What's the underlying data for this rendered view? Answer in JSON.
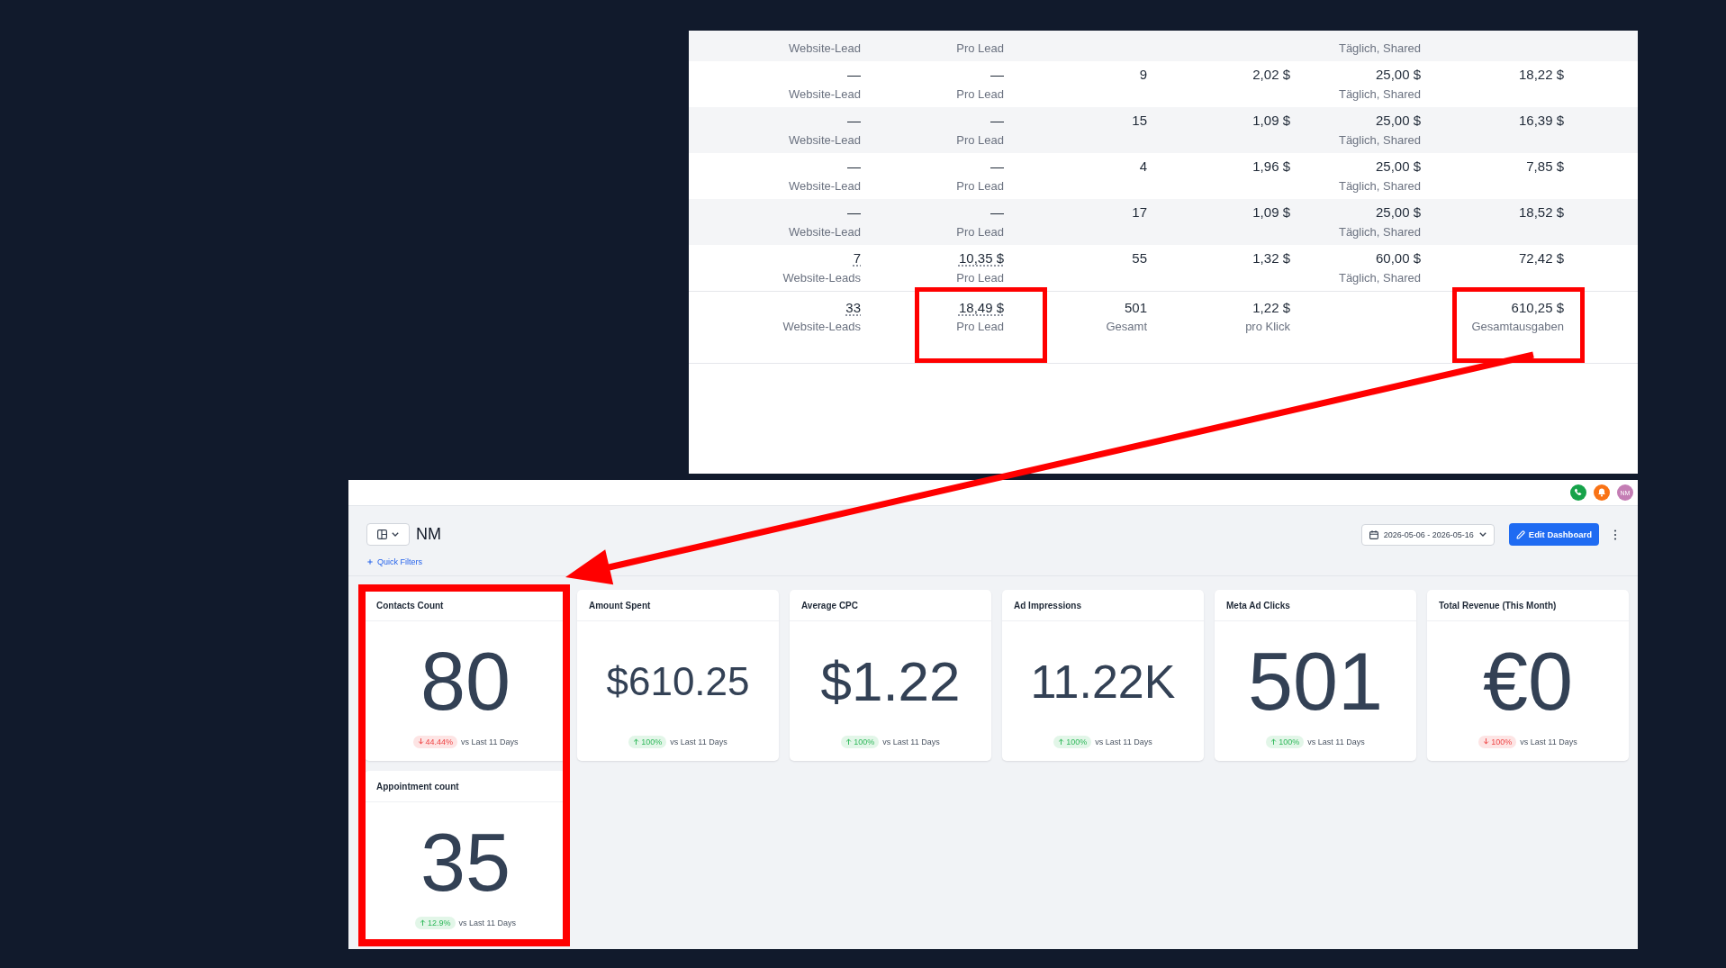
{
  "table_panel": {
    "rows": [
      {
        "column_1": {
          "sub": "Website-Lead"
        },
        "column_2": {
          "sub": "Pro Lead"
        },
        "column_5": {
          "sub": "Täglich, Shared"
        }
      },
      {
        "column_1": {
          "value": "—",
          "sub": "Website-Lead",
          "dotted": false
        },
        "column_2": {
          "value": "—",
          "sub": "Pro Lead",
          "dotted": false
        },
        "column_3": {
          "value": "9",
          "dotted": false
        },
        "column_4": {
          "value": "2,02 $",
          "dotted": false
        },
        "column_5": {
          "value": "25,00 $",
          "sub": "Täglich, Shared",
          "dotted": false
        },
        "column_6": {
          "value": "18,22 $",
          "dotted": false
        }
      },
      {
        "column_1": {
          "value": "—",
          "sub": "Website-Lead",
          "dotted": false
        },
        "column_2": {
          "value": "—",
          "sub": "Pro Lead",
          "dotted": false
        },
        "column_3": {
          "value": "15",
          "dotted": false
        },
        "column_4": {
          "value": "1,09 $",
          "dotted": false
        },
        "column_5": {
          "value": "25,00 $",
          "sub": "Täglich, Shared",
          "dotted": false
        },
        "column_6": {
          "value": "16,39 $",
          "dotted": false
        }
      },
      {
        "column_1": {
          "value": "—",
          "sub": "Website-Lead",
          "dotted": false
        },
        "column_2": {
          "value": "—",
          "sub": "Pro Lead",
          "dotted": false
        },
        "column_3": {
          "value": "4",
          "dotted": false
        },
        "column_4": {
          "value": "1,96 $",
          "dotted": false
        },
        "column_5": {
          "value": "25,00 $",
          "sub": "Täglich, Shared",
          "dotted": false
        },
        "column_6": {
          "value": "7,85 $",
          "dotted": false
        }
      },
      {
        "column_1": {
          "value": "—",
          "sub": "Website-Lead",
          "dotted": false
        },
        "column_2": {
          "value": "—",
          "sub": "Pro Lead",
          "dotted": false
        },
        "column_3": {
          "value": "17",
          "dotted": false
        },
        "column_4": {
          "value": "1,09 $",
          "dotted": false
        },
        "column_5": {
          "value": "25,00 $",
          "sub": "Täglich, Shared",
          "dotted": false
        },
        "column_6": {
          "value": "18,52 $",
          "dotted": false
        }
      },
      {
        "column_1": {
          "value": "7",
          "sub": "Website-Leads",
          "dotted": true
        },
        "column_2": {
          "value": "10,35 $",
          "sub": "Pro Lead",
          "dotted": true
        },
        "column_3": {
          "value": "55",
          "dotted": false
        },
        "column_4": {
          "value": "1,32 $",
          "dotted": false
        },
        "column_5": {
          "value": "60,00 $",
          "sub": "Täglich, Shared",
          "dotted": false
        },
        "column_6": {
          "value": "72,42 $",
          "dotted": false
        }
      }
    ],
    "totals": {
      "column_1": {
        "value": "33",
        "sub": "Website-Leads",
        "dotted": true,
        "highlighted": false
      },
      "column_2": {
        "value": "18,49 $",
        "sub": "Pro Lead",
        "dotted": true,
        "highlighted": true
      },
      "column_3": {
        "value": "501",
        "sub": "Gesamt",
        "dotted": false,
        "highlighted": false
      },
      "column_4": {
        "value": "1,22 $",
        "sub": "pro Klick",
        "dotted": false,
        "highlighted": false
      },
      "column_6": {
        "value": "610,25 $",
        "sub": "Gesamtausgaben",
        "dotted": false,
        "highlighted": true
      }
    }
  },
  "arrow_shown": true,
  "dashboard": {
    "top_bar": {
      "avatar_initials": "NM"
    },
    "title": "NM",
    "quick_filters": "Quick Filters",
    "date_range": "2026-05-06 - 2026-05-16",
    "edit_button": "Edit Dashboard",
    "cards": [
      {
        "title": "Contacts Count",
        "value": "80",
        "change": "44.44%",
        "increase": false,
        "comparison": "vs Last 11 Days",
        "highlighted": true
      },
      {
        "title": "Amount Spent",
        "value": "$610.25",
        "change": "100%",
        "increase": true,
        "comparison": "vs Last 11 Days",
        "highlighted": false
      },
      {
        "title": "Average CPC",
        "value": "$1.22",
        "change": "100%",
        "increase": true,
        "comparison": "vs Last 11 Days",
        "highlighted": false
      },
      {
        "title": "Ad Impressions",
        "value": "11.22K",
        "change": "100%",
        "increase": true,
        "comparison": "vs Last 11 Days",
        "highlighted": false
      },
      {
        "title": "Meta Ad Clicks",
        "value": "501",
        "change": "100%",
        "increase": true,
        "comparison": "vs Last 11 Days",
        "highlighted": false
      },
      {
        "title": "Total Revenue (This Month)",
        "value": "€0",
        "change": "100%",
        "increase": false,
        "comparison": "vs Last 11 Days",
        "highlighted": false
      },
      {
        "title": "Appointment count",
        "value": "35",
        "change": "12.9%",
        "increase": true,
        "comparison": "vs Last 11 Days",
        "highlighted": true
      }
    ]
  }
}
